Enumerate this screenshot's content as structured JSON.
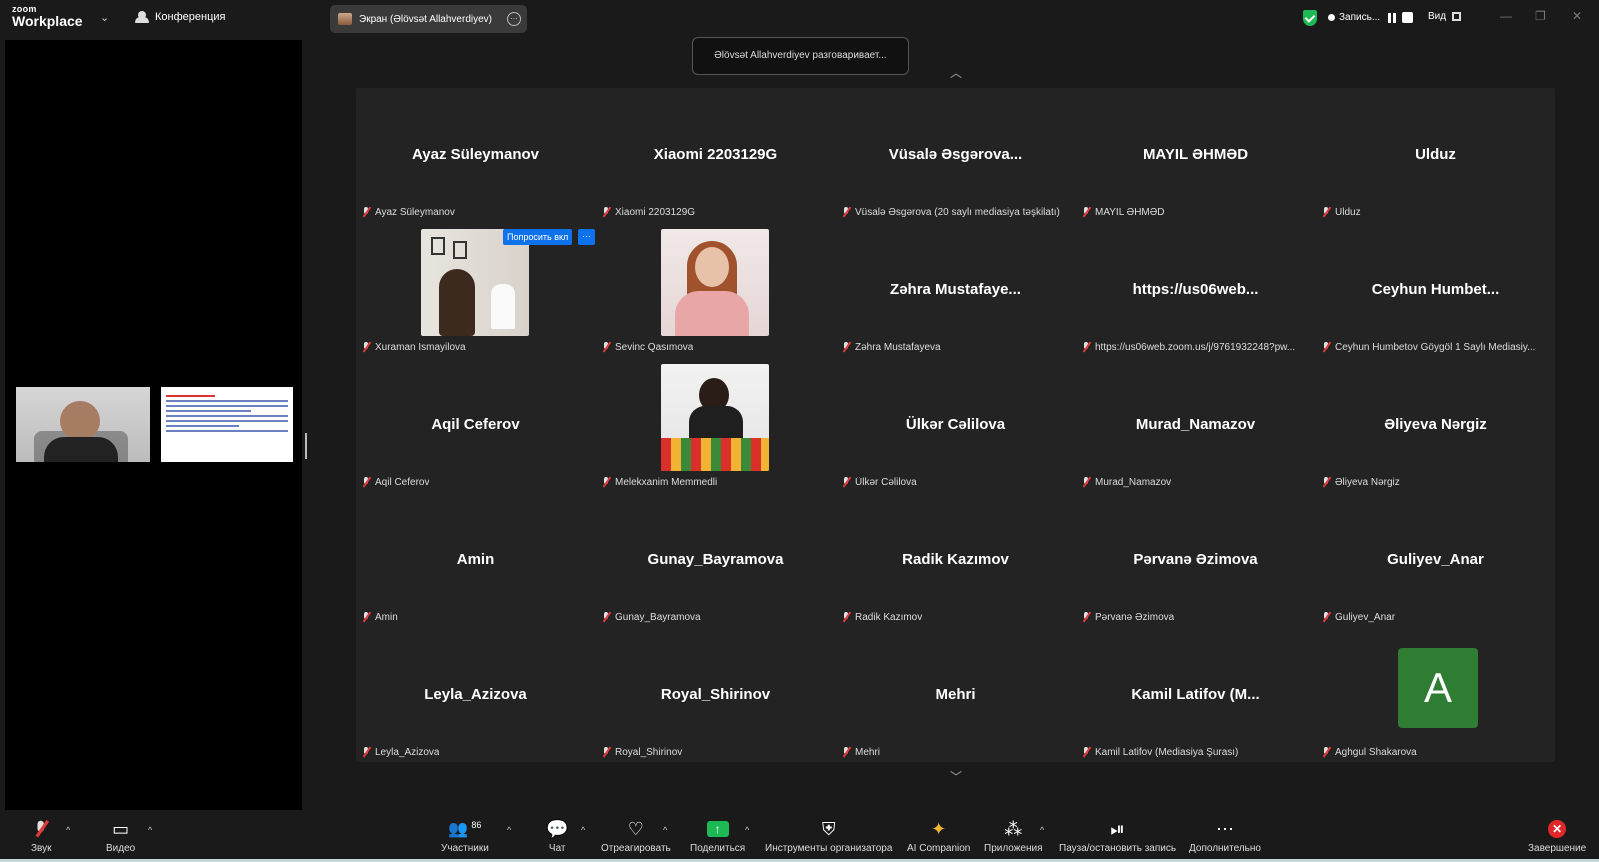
{
  "app": {
    "logo_small": "zoom",
    "logo_big": "Workplace"
  },
  "topbar": {
    "conference_label": "Конференция",
    "screen_share_label": "Экран (Əlövsət Allahverdiyev)",
    "record_label": "Запись...",
    "view_label": "Вид",
    "accent_color": "#1db954"
  },
  "talking_banner": "Əlövsət Allahverdiyev разговаривает...",
  "ask_button": {
    "label": "Попросить вкл",
    "more": "···"
  },
  "tiles": [
    {
      "big": "Ayaz Süleymanov",
      "label": "Ayaz Süleymanov"
    },
    {
      "big": "Xiaomi 2203129G",
      "label": "Xiaomi 2203129G"
    },
    {
      "big": "Vüsalə Əsgərova...",
      "label": "Vüsalə Əsgərova (20 saylı mediasiya təşkilatı)"
    },
    {
      "big": "MAYIL ƏHMƏD",
      "label": "MAYIL ƏHMƏD"
    },
    {
      "big": "Ulduz",
      "label": "Ulduz"
    },
    {
      "big": "",
      "label": "Xuraman İsmayilova"
    },
    {
      "big": "",
      "label": "Sevinc Qasımova"
    },
    {
      "big": "Zəhra Mustafaye...",
      "label": "Zəhra Mustafayeva"
    },
    {
      "big": "https://us06web...",
      "label": "https://us06web.zoom.us/j/9761932248?pw..."
    },
    {
      "big": "Ceyhun Humbet...",
      "label": "Ceyhun Humbetov Göygöl 1 Saylı Mediasiy..."
    },
    {
      "big": "Aqil Ceferov",
      "label": "Aqil Ceferov"
    },
    {
      "big": "",
      "label": "Melekxanim Memmedli"
    },
    {
      "big": "Ülkər Cəlilova",
      "label": "Ülkər Cəlilova"
    },
    {
      "big": "Murad_Namazov",
      "label": "Murad_Namazov"
    },
    {
      "big": "Əliyeva Nərgiz",
      "label": "Əliyeva Nərgiz"
    },
    {
      "big": "Amin",
      "label": "Amin"
    },
    {
      "big": "Gunay_Bayramova",
      "label": "Gunay_Bayramova"
    },
    {
      "big": "Radik Kazımov",
      "label": "Radik Kazımov"
    },
    {
      "big": "Pərvanə Əzimova",
      "label": "Pərvanə Əzimova"
    },
    {
      "big": "Guliyev_Anar",
      "label": "Guliyev_Anar"
    },
    {
      "big": "Leyla_Azizova",
      "label": "Leyla_Azizova"
    },
    {
      "big": "Royal_Shirinov",
      "label": "Royal_Shirinov"
    },
    {
      "big": "Mehri",
      "label": "Mehri"
    },
    {
      "big": "Kamil Latifov (M...",
      "label": "Kamil Latifov (Mediasiya Şurası)"
    },
    {
      "big": "",
      "label": "Aghgul Shakarova",
      "avatar": "A"
    }
  ],
  "bottombar": {
    "audio": "Звук",
    "video": "Видео",
    "participants": "Участники",
    "participants_count": "86",
    "chat": "Чат",
    "react": "Отреагировать",
    "share": "Поделиться",
    "host_tools": "Инструменты организатора",
    "ai": "AI Companion",
    "apps": "Приложения",
    "pause_record": "Пауза/остановить запись",
    "more": "Дополнительно",
    "end": "Завершение"
  }
}
